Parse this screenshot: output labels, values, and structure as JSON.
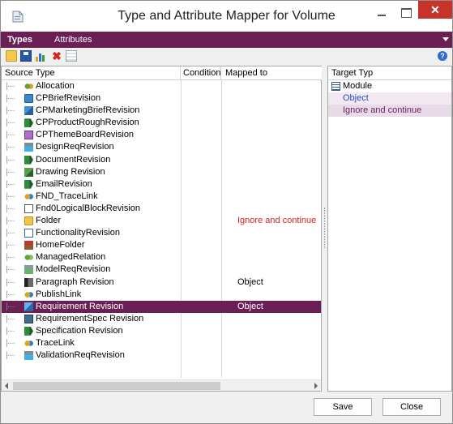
{
  "window": {
    "title": "Type and Attribute Mapper for Volume",
    "close_glyph": "✕"
  },
  "tabs": [
    {
      "label": "Types",
      "active": true
    },
    {
      "label": "Attributes",
      "active": false
    }
  ],
  "toolbar": {
    "icons": [
      "open-folder-icon",
      "save-icon",
      "chart-icon",
      "delete-icon",
      "grid-icon",
      "help-icon"
    ],
    "help_glyph": "?"
  },
  "left_table": {
    "columns": [
      "Source Type",
      "Condition",
      "Mapped to"
    ],
    "rows": [
      {
        "label": "Allocation",
        "icon": "link-icon",
        "mapped": "",
        "selected": false
      },
      {
        "label": "CPBriefRevision",
        "icon": "document-icon",
        "mapped": "",
        "selected": false
      },
      {
        "label": "CPMarketingBriefRevision",
        "icon": "marketing-brief-icon",
        "mapped": "",
        "selected": false
      },
      {
        "label": "CPProductRoughRevision",
        "icon": "product-rough-icon",
        "mapped": "",
        "selected": false
      },
      {
        "label": "CPThemeBoardRevision",
        "icon": "theme-board-icon",
        "mapped": "",
        "selected": false
      },
      {
        "label": "DesignReqRevision",
        "icon": "design-req-icon",
        "mapped": "",
        "selected": false
      },
      {
        "label": "DocumentRevision",
        "icon": "document-revision-icon",
        "mapped": "",
        "selected": false
      },
      {
        "label": "Drawing Revision",
        "icon": "drawing-icon",
        "mapped": "",
        "selected": false
      },
      {
        "label": "EmailRevision",
        "icon": "email-icon",
        "mapped": "",
        "selected": false
      },
      {
        "label": "FND_TraceLink",
        "icon": "trace-link-icon",
        "mapped": "",
        "selected": false
      },
      {
        "label": "Fnd0LogicalBlockRevision",
        "icon": "logical-block-icon",
        "mapped": "",
        "selected": false
      },
      {
        "label": "Folder",
        "icon": "folder-icon",
        "mapped": "Ignore and continue",
        "selected": false
      },
      {
        "label": "FunctionalityRevision",
        "icon": "functionality-icon",
        "mapped": "",
        "selected": false
      },
      {
        "label": "HomeFolder",
        "icon": "home-folder-icon",
        "mapped": "",
        "selected": false
      },
      {
        "label": "ManagedRelation",
        "icon": "managed-relation-icon",
        "mapped": "",
        "selected": false
      },
      {
        "label": "ModelReqRevision",
        "icon": "model-req-icon",
        "mapped": "",
        "selected": false
      },
      {
        "label": "Paragraph Revision",
        "icon": "paragraph-icon",
        "mapped": "Object",
        "selected": false
      },
      {
        "label": "PublishLink",
        "icon": "publish-link-icon",
        "mapped": "",
        "selected": false
      },
      {
        "label": "Requirement Revision",
        "icon": "requirement-icon",
        "mapped": "Object",
        "selected": true
      },
      {
        "label": "RequirementSpec Revision",
        "icon": "requirement-spec-icon",
        "mapped": "",
        "selected": false
      },
      {
        "label": "Specification Revision",
        "icon": "specification-icon",
        "mapped": "",
        "selected": false
      },
      {
        "label": "TraceLink",
        "icon": "trace-link-icon",
        "mapped": "",
        "selected": false
      },
      {
        "label": "ValidationReqRevision",
        "icon": "validation-req-icon",
        "mapped": "",
        "selected": false
      }
    ]
  },
  "right_panel": {
    "header": "Target Typ",
    "items": [
      {
        "label": "Module",
        "icon": "module-icon",
        "style": "normal"
      },
      {
        "label": "Object",
        "icon": "",
        "style": "hl1"
      },
      {
        "label": "Ignore and continue",
        "icon": "",
        "style": "hl2"
      }
    ]
  },
  "buttons": {
    "save": "Save",
    "close": "Close"
  },
  "colors": {
    "accent": "#6b1f54",
    "ignore_text": "#d8231b",
    "object_text": "#2a4fb1"
  }
}
